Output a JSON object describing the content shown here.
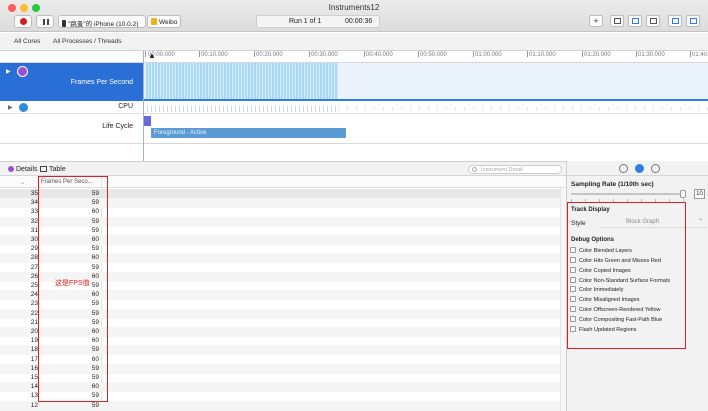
{
  "window": {
    "title": "Instruments12"
  },
  "toolbar": {
    "device": "\"跳蚤\"的 iPhone (10.0.2)",
    "target": "Weibo",
    "run_label": "Run 1 of 1",
    "run_time": "00:00:36",
    "add_label": "+"
  },
  "scope": {
    "cores": "All Cores",
    "processes": "All Processes / Threads"
  },
  "timeline": {
    "ticks": [
      "00:00.000",
      "00:10.000",
      "00:20.000",
      "00:30.000",
      "00:40.000",
      "00:50.000",
      "01:00.000",
      "01:10.000",
      "01:20.000",
      "01:30.000",
      "01:40.000"
    ]
  },
  "tracks": {
    "fps": "Frames Per Second",
    "cpu": "CPU",
    "lifecycle": "Life Cycle",
    "lifecycle_state": "Foreground - Active"
  },
  "details": {
    "details_label": "Details",
    "table_label": "Table",
    "search_placeholder": "Instrument Detail",
    "column_header": "Frames Per Seco..."
  },
  "rows": [
    {
      "n": "35",
      "v": "59"
    },
    {
      "n": "34",
      "v": "59"
    },
    {
      "n": "33",
      "v": "60"
    },
    {
      "n": "32",
      "v": "59"
    },
    {
      "n": "31",
      "v": "59"
    },
    {
      "n": "30",
      "v": "60"
    },
    {
      "n": "29",
      "v": "59"
    },
    {
      "n": "28",
      "v": "60"
    },
    {
      "n": "27",
      "v": "59"
    },
    {
      "n": "26",
      "v": "60"
    },
    {
      "n": "25",
      "v": "59"
    },
    {
      "n": "24",
      "v": "60"
    },
    {
      "n": "23",
      "v": "59"
    },
    {
      "n": "22",
      "v": "59"
    },
    {
      "n": "21",
      "v": "59"
    },
    {
      "n": "20",
      "v": "60"
    },
    {
      "n": "19",
      "v": "60"
    },
    {
      "n": "18",
      "v": "59"
    },
    {
      "n": "17",
      "v": "60"
    },
    {
      "n": "16",
      "v": "59"
    },
    {
      "n": "15",
      "v": "59"
    },
    {
      "n": "14",
      "v": "60"
    },
    {
      "n": "13",
      "v": "59"
    },
    {
      "n": "12",
      "v": "59"
    }
  ],
  "annotation": "这是FPS值",
  "inspector": {
    "sampling_title": "Sampling Rate (1/10th sec)",
    "sampling_value": "10",
    "track_display": "Track Display",
    "style_label": "Style",
    "style_value": "Block Graph",
    "debug_title": "Debug Options",
    "options": [
      "Color Blended Layers",
      "Color Hits Green and Misses Red",
      "Color Copied Images",
      "Color Non-Standard Surface Formats",
      "Color Immediately",
      "Color Misaligned Images",
      "Color Offscreen-Rendered Yellow",
      "Color Compositing Fast-Path Blue",
      "Flash Updated Regions"
    ]
  },
  "colors": {
    "accent": "#2f7fe0",
    "highlight": "#e02020",
    "record": "#d32020"
  }
}
